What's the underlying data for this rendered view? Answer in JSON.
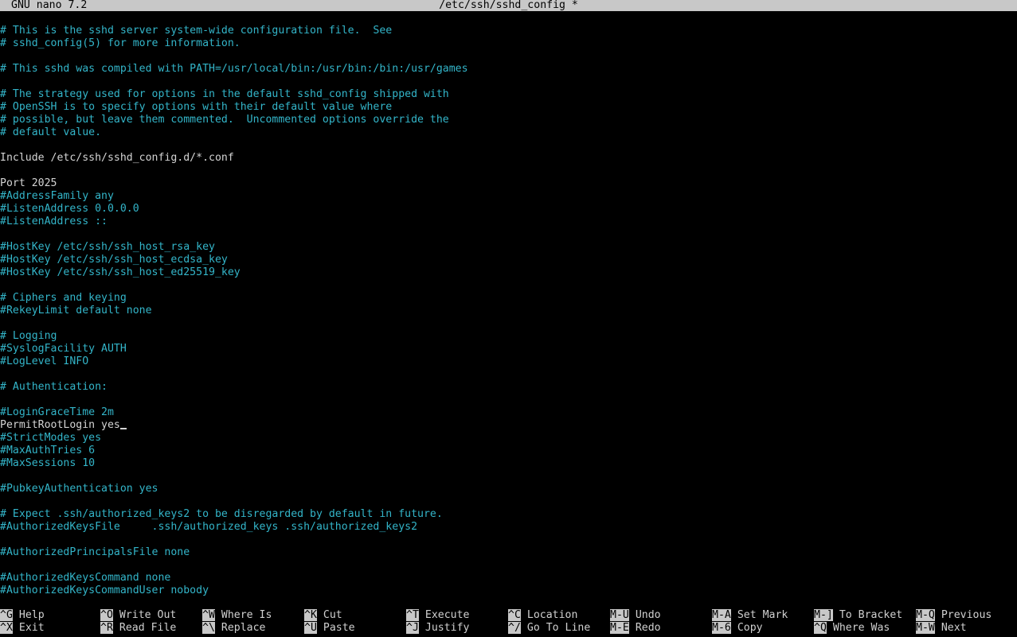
{
  "titlebar": {
    "app": "GNU nano 7.2",
    "file": "/etc/ssh/sshd_config *"
  },
  "editor": {
    "lines": [
      {
        "text": "# This is the sshd server system-wide configuration file.  See",
        "type": "comment"
      },
      {
        "text": "# sshd_config(5) for more information.",
        "type": "comment"
      },
      {
        "text": "",
        "type": "blank"
      },
      {
        "text": "# This sshd was compiled with PATH=/usr/local/bin:/usr/bin:/bin:/usr/games",
        "type": "comment"
      },
      {
        "text": "",
        "type": "blank"
      },
      {
        "text": "# The strategy used for options in the default sshd_config shipped with",
        "type": "comment"
      },
      {
        "text": "# OpenSSH is to specify options with their default value where",
        "type": "comment"
      },
      {
        "text": "# possible, but leave them commented.  Uncommented options override the",
        "type": "comment"
      },
      {
        "text": "# default value.",
        "type": "comment"
      },
      {
        "text": "",
        "type": "blank"
      },
      {
        "text": "Include /etc/ssh/sshd_config.d/*.conf",
        "type": "code"
      },
      {
        "text": "",
        "type": "blank"
      },
      {
        "text": "Port 2025",
        "type": "code"
      },
      {
        "text": "#AddressFamily any",
        "type": "comment"
      },
      {
        "text": "#ListenAddress 0.0.0.0",
        "type": "comment"
      },
      {
        "text": "#ListenAddress ::",
        "type": "comment"
      },
      {
        "text": "",
        "type": "blank"
      },
      {
        "text": "#HostKey /etc/ssh/ssh_host_rsa_key",
        "type": "comment"
      },
      {
        "text": "#HostKey /etc/ssh/ssh_host_ecdsa_key",
        "type": "comment"
      },
      {
        "text": "#HostKey /etc/ssh/ssh_host_ed25519_key",
        "type": "comment"
      },
      {
        "text": "",
        "type": "blank"
      },
      {
        "text": "# Ciphers and keying",
        "type": "comment"
      },
      {
        "text": "#RekeyLimit default none",
        "type": "comment"
      },
      {
        "text": "",
        "type": "blank"
      },
      {
        "text": "# Logging",
        "type": "comment"
      },
      {
        "text": "#SyslogFacility AUTH",
        "type": "comment"
      },
      {
        "text": "#LogLevel INFO",
        "type": "comment"
      },
      {
        "text": "",
        "type": "blank"
      },
      {
        "text": "# Authentication:",
        "type": "comment"
      },
      {
        "text": "",
        "type": "blank"
      },
      {
        "text": "#LoginGraceTime 2m",
        "type": "comment"
      },
      {
        "text": "PermitRootLogin yes",
        "type": "code",
        "cursor": true
      },
      {
        "text": "#StrictModes yes",
        "type": "comment"
      },
      {
        "text": "#MaxAuthTries 6",
        "type": "comment"
      },
      {
        "text": "#MaxSessions 10",
        "type": "comment"
      },
      {
        "text": "",
        "type": "blank"
      },
      {
        "text": "#PubkeyAuthentication yes",
        "type": "comment"
      },
      {
        "text": "",
        "type": "blank"
      },
      {
        "text": "# Expect .ssh/authorized_keys2 to be disregarded by default in future.",
        "type": "comment"
      },
      {
        "text": "#AuthorizedKeysFile     .ssh/authorized_keys .ssh/authorized_keys2",
        "type": "comment"
      },
      {
        "text": "",
        "type": "blank"
      },
      {
        "text": "#AuthorizedPrincipalsFile none",
        "type": "comment"
      },
      {
        "text": "",
        "type": "blank"
      },
      {
        "text": "#AuthorizedKeysCommand none",
        "type": "comment"
      },
      {
        "text": "#AuthorizedKeysCommandUser nobody",
        "type": "comment"
      }
    ]
  },
  "shortcuts": [
    {
      "key": "^G",
      "label": "Help"
    },
    {
      "key": "^X",
      "label": "Exit"
    },
    {
      "key": "^O",
      "label": "Write Out"
    },
    {
      "key": "^R",
      "label": "Read File"
    },
    {
      "key": "^W",
      "label": "Where Is"
    },
    {
      "key": "^\\",
      "label": "Replace"
    },
    {
      "key": "^K",
      "label": "Cut"
    },
    {
      "key": "^U",
      "label": "Paste"
    },
    {
      "key": "^T",
      "label": "Execute"
    },
    {
      "key": "^J",
      "label": "Justify"
    },
    {
      "key": "^C",
      "label": "Location"
    },
    {
      "key": "^/",
      "label": "Go To Line"
    },
    {
      "key": "M-U",
      "label": "Undo"
    },
    {
      "key": "M-E",
      "label": "Redo"
    },
    {
      "key": "M-A",
      "label": "Set Mark"
    },
    {
      "key": "M-6",
      "label": "Copy"
    },
    {
      "key": "M-]",
      "label": "To Bracket"
    },
    {
      "key": "^Q",
      "label": "Where Was"
    },
    {
      "key": "M-Q",
      "label": "Previous"
    },
    {
      "key": "M-W",
      "label": "Next"
    }
  ],
  "colors": {
    "background": "#000000",
    "comment": "#33b5c9",
    "code": "#d4d4d4",
    "bar": "#c8c8c8"
  }
}
